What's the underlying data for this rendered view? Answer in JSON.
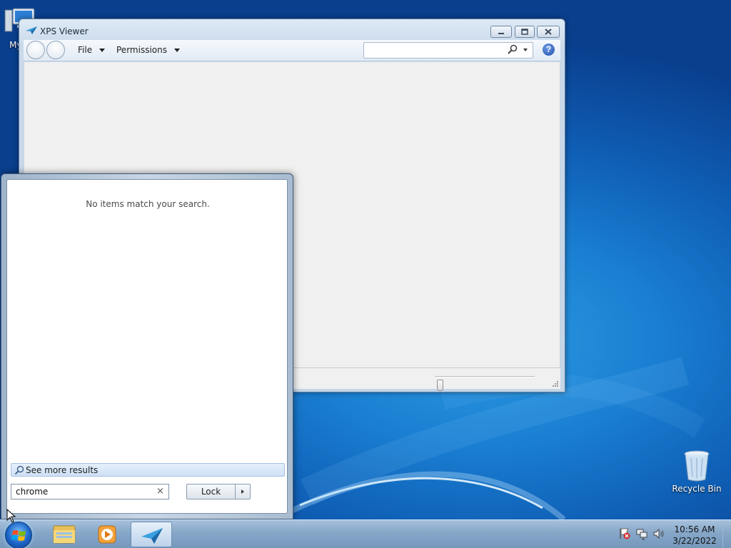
{
  "desktop": {
    "icons": [
      {
        "label": "My C",
        "icon": "computer-icon"
      },
      {
        "label": "Recycle Bin",
        "icon": "recycle-bin-icon"
      }
    ]
  },
  "xps_window": {
    "title": "XPS Viewer",
    "menus": [
      {
        "label": "File"
      },
      {
        "label": "Permissions"
      }
    ],
    "search": {
      "value": ""
    },
    "help": {
      "icon": "help-icon",
      "glyph": "?"
    },
    "zoom": {
      "level": 0.02
    }
  },
  "start_menu": {
    "no_results_text": "No items match your search.",
    "see_more_label": "See more results",
    "search_value": "chrome",
    "clear_glyph": "×",
    "power_button_label": "Lock"
  },
  "taskbar": {
    "buttons": [
      {
        "name": "start-button",
        "icon": "windows-orb-icon"
      },
      {
        "name": "windows-explorer",
        "icon": "folder-icon"
      },
      {
        "name": "windows-media-player",
        "icon": "media-player-icon"
      },
      {
        "name": "xps-viewer",
        "icon": "xps-viewer-icon",
        "active": true
      }
    ],
    "tray_icons": [
      "action-center-icon",
      "network-icon",
      "volume-icon"
    ],
    "clock": {
      "time": "10:56 AM",
      "date": "3/22/2022"
    }
  },
  "colors": {
    "desktop": "#1a7fd2",
    "start_menu_bg": "#ffffff",
    "see_more_highlight": "#d6e6f8"
  }
}
